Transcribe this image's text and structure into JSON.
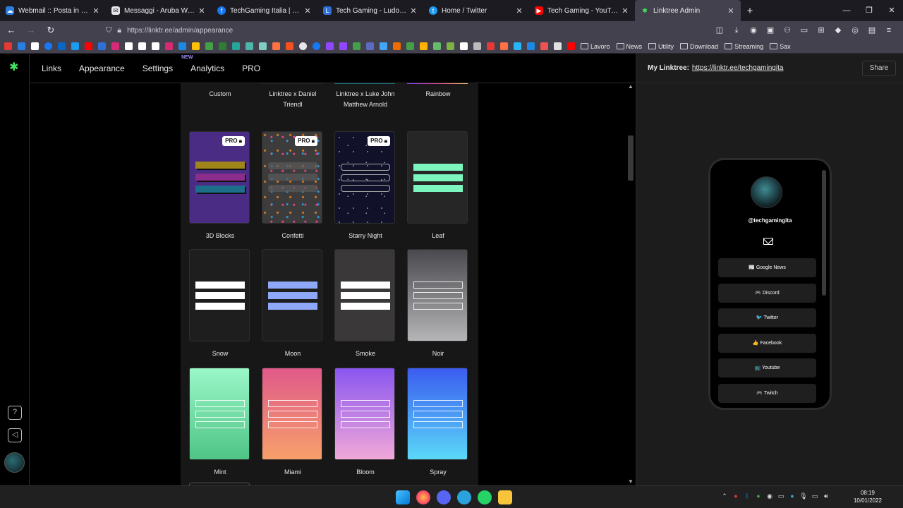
{
  "browser": {
    "tabs": [
      {
        "title": "Webmail :: Posta in arrivo",
        "icon": "cloud-icon",
        "color": "#2a7de1"
      },
      {
        "title": "Messaggi - Aruba Webmail",
        "icon": "mail-icon",
        "color": "#e6e6ea"
      },
      {
        "title": "TechGaming Italia | Facebook",
        "icon": "facebook-icon",
        "color": "#1877f2"
      },
      {
        "title": "Tech Gaming - Ludomedia",
        "icon": "ludomedia-icon",
        "color": "#2e6fd8"
      },
      {
        "title": "Home / Twitter",
        "icon": "twitter-icon",
        "color": "#1d9bf0"
      },
      {
        "title": "Tech Gaming - YouTube",
        "icon": "youtube-icon",
        "color": "#ff0000"
      },
      {
        "title": "Linktree Admin",
        "icon": "linktree-icon",
        "color": "#43e660"
      }
    ],
    "url": "https://linktr.ee/admin/appearance",
    "bookmark_folders": [
      "Lavoro",
      "News",
      "Utility",
      "Download",
      "Streaming",
      "Sax"
    ]
  },
  "nav": {
    "links": "Links",
    "appearance": "Appearance",
    "settings": "Settings",
    "analytics": "Analytics",
    "analytics_badge": "NEW",
    "pro": "PRO"
  },
  "themes_top_row": [
    "Custom",
    "Linktree x Daniel Triendl",
    "Linktree x Luke John Matthew Arnold",
    "Rainbow"
  ],
  "themes": [
    {
      "name": "3D Blocks",
      "pro": true
    },
    {
      "name": "Confetti",
      "pro": true
    },
    {
      "name": "Starry Night",
      "pro": true
    },
    {
      "name": "Leaf",
      "pro": false
    },
    {
      "name": "Snow",
      "pro": false
    },
    {
      "name": "Moon",
      "pro": false
    },
    {
      "name": "Smoke",
      "pro": false
    },
    {
      "name": "Noir",
      "pro": false
    },
    {
      "name": "Mint",
      "pro": false
    },
    {
      "name": "Miami",
      "pro": false
    },
    {
      "name": "Bloom",
      "pro": false
    },
    {
      "name": "Spray",
      "pro": false
    }
  ],
  "pro_label": "PRO",
  "preview": {
    "label": "My Linktree:",
    "url": "https://linktr.ee/techgamingita",
    "share": "Share",
    "handle": "@techgamingita",
    "links": [
      "📰 Google News",
      "🎮 Discord",
      "🐦 Twitter",
      "👍 Facebook",
      "📺 Youtube",
      "🎮 Twitch"
    ]
  },
  "taskbar": {
    "time": "08:19",
    "date": "10/01/2022"
  }
}
